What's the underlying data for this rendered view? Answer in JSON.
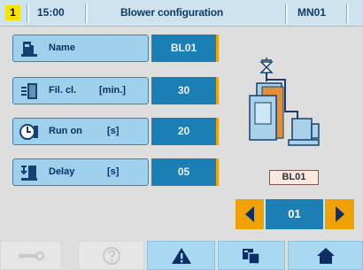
{
  "header": {
    "screen_number": "1",
    "time": "15:00",
    "title": "Blower configuration",
    "unit_code": "MN01"
  },
  "rows": [
    {
      "label": "Name",
      "unit": "",
      "value": "BL01",
      "icon": "device-icon"
    },
    {
      "label": "Fil. cl.",
      "unit": "[min.]",
      "value": "30",
      "icon": "filter-icon"
    },
    {
      "label": "Run on",
      "unit": "[s]",
      "value": "20",
      "icon": "clock-icon"
    },
    {
      "label": "Delay",
      "unit": "[s]",
      "value": "05",
      "icon": "delay-icon"
    }
  ],
  "diagram": {
    "device_label": "BL01",
    "selector_value": "01"
  },
  "toolbar": [
    {
      "icon": "wrench-icon",
      "state": "disabled"
    },
    {
      "icon": "help-icon",
      "state": "disabled"
    },
    {
      "icon": "warning-icon",
      "state": "active"
    },
    {
      "icon": "screens-icon",
      "state": "active"
    },
    {
      "icon": "home-icon",
      "state": "active"
    }
  ],
  "colors": {
    "accent_orange": "#f0a200",
    "value_blue": "#1b7fb6",
    "label_blue": "#9fd0ec",
    "header_bg": "#cfe3ef"
  }
}
